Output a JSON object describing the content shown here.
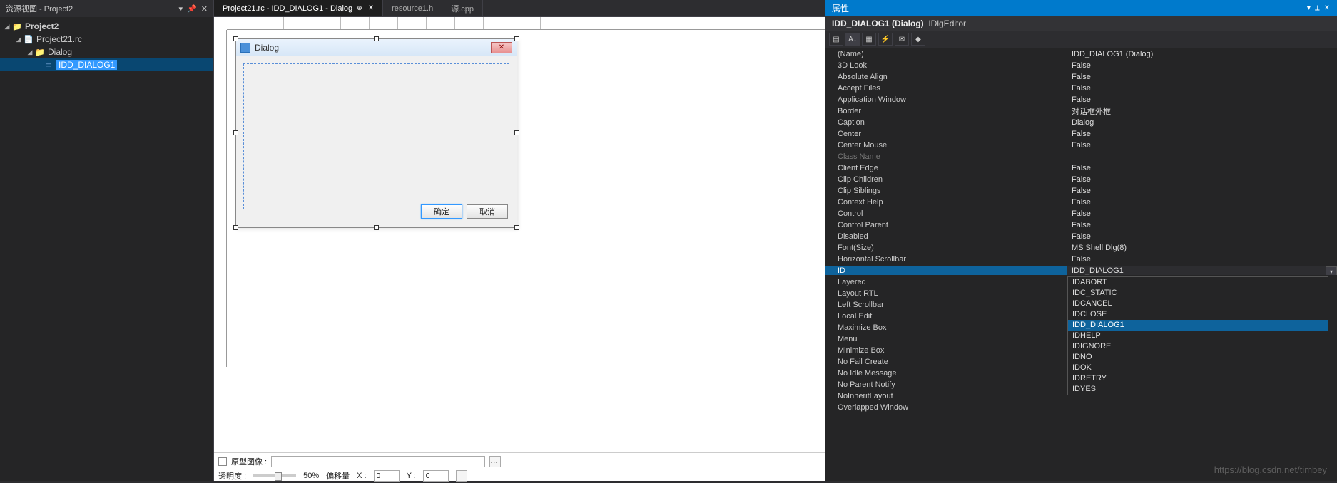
{
  "left_panel": {
    "title": "资源视图 - Project2",
    "tree": {
      "project": "Project2",
      "rc": "Project21.rc",
      "folder": "Dialog",
      "item": "IDD_DIALOG1"
    }
  },
  "tabs": [
    {
      "label": "Project21.rc - IDD_DIALOG1 - Dialog",
      "active": true,
      "pinned": true
    },
    {
      "label": "resource1.h",
      "active": false
    },
    {
      "label": "源.cpp",
      "active": false
    }
  ],
  "dialog_designer": {
    "title": "Dialog",
    "ok_button": "确定",
    "cancel_button": "取消"
  },
  "status_bar": {
    "proto_image_label": "原型图像 :",
    "transparency_label": "透明度 :",
    "transparency_pct": "50%",
    "offset_label": "偏移量",
    "x_label": "X :",
    "x_value": "0",
    "y_label": "Y :",
    "y_value": "0"
  },
  "properties": {
    "header_title": "属性",
    "subheader_bold": "IDD_DIALOG1 (Dialog)",
    "subheader_rest": "IDlgEditor",
    "rows": [
      {
        "name": "(Name)",
        "value": "IDD_DIALOG1 (Dialog)"
      },
      {
        "name": "3D Look",
        "value": "False"
      },
      {
        "name": "Absolute Align",
        "value": "False"
      },
      {
        "name": "Accept Files",
        "value": "False"
      },
      {
        "name": "Application Window",
        "value": "False"
      },
      {
        "name": "Border",
        "value": "对话框外框"
      },
      {
        "name": "Caption",
        "value": "Dialog"
      },
      {
        "name": "Center",
        "value": "False"
      },
      {
        "name": "Center Mouse",
        "value": "False"
      },
      {
        "name": "Class Name",
        "value": "",
        "disabled": true
      },
      {
        "name": "Client Edge",
        "value": "False"
      },
      {
        "name": "Clip Children",
        "value": "False"
      },
      {
        "name": "Clip Siblings",
        "value": "False"
      },
      {
        "name": "Context Help",
        "value": "False"
      },
      {
        "name": "Control",
        "value": "False"
      },
      {
        "name": "Control Parent",
        "value": "False"
      },
      {
        "name": "Disabled",
        "value": "False"
      },
      {
        "name": "Font(Size)",
        "value": "MS Shell Dlg(8)"
      },
      {
        "name": "Horizontal Scrollbar",
        "value": "False"
      },
      {
        "name": "ID",
        "value": "IDD_DIALOG1",
        "selected": true
      },
      {
        "name": "Layered",
        "value": ""
      },
      {
        "name": "Layout RTL",
        "value": ""
      },
      {
        "name": "Left Scrollbar",
        "value": ""
      },
      {
        "name": "Local Edit",
        "value": ""
      },
      {
        "name": "Maximize Box",
        "value": ""
      },
      {
        "name": "Menu",
        "value": ""
      },
      {
        "name": "Minimize Box",
        "value": ""
      },
      {
        "name": "No Fail Create",
        "value": ""
      },
      {
        "name": "No Idle Message",
        "value": ""
      },
      {
        "name": "No Parent Notify",
        "value": ""
      },
      {
        "name": "NoInheritLayout",
        "value": ""
      },
      {
        "name": "Overlapped Window",
        "value": ""
      }
    ],
    "dropdown_options": [
      "IDABORT",
      "IDC_STATIC",
      "IDCANCEL",
      "IDCLOSE",
      "IDD_DIALOG1",
      "IDHELP",
      "IDIGNORE",
      "IDNO",
      "IDOK",
      "IDRETRY",
      "IDYES"
    ],
    "dropdown_highlight": "IDD_DIALOG1"
  },
  "watermark": "https://blog.csdn.net/timbey"
}
